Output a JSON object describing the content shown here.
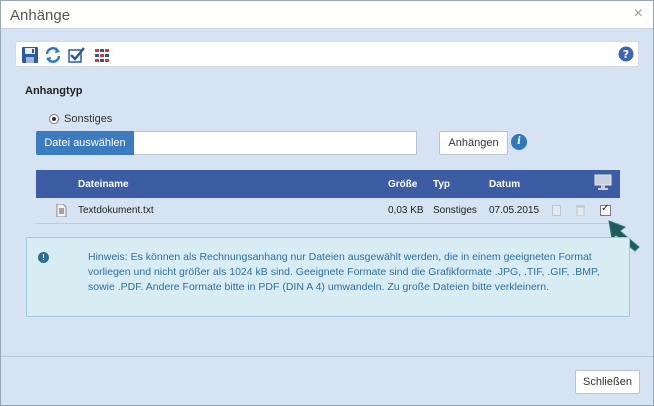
{
  "window": {
    "title": "Anhänge",
    "close_glyph": "×"
  },
  "toolbar": {
    "icons": [
      "save-icon",
      "refresh-icon",
      "check-icon",
      "grid-icon"
    ],
    "help_icon": "help-icon"
  },
  "section": {
    "title": "Anhangtyp"
  },
  "radio": {
    "label": "Sonstiges",
    "selected": true
  },
  "file": {
    "button_label": "Datei auswählen",
    "input_value": ""
  },
  "attach": {
    "button_label": "Anhängen"
  },
  "table": {
    "headers": {
      "name": "Dateiname",
      "size": "Größe",
      "type": "Typ",
      "date": "Datum"
    },
    "rows": [
      {
        "name": "Textdokument.txt",
        "size": "0,03 KB",
        "type": "Sonstiges",
        "date": "07.05.2015",
        "checked": true
      }
    ]
  },
  "hint": {
    "icon": "info-icon",
    "text": "Hinweis: Es können als Rechnungsanhang nur Dateien ausgewählt werden, die in einem geeigneten Format vorliegen und nicht größer als 1024 kB sind. Geeignete Formate sind die Grafikformate .JPG, .TIF, .GIF, .BMP, sowie .PDF. Andere Formate bitte in PDF (DIN A 4) umwandeln. Zu große Dateien bitte verkleinern."
  },
  "footer": {
    "close_label": "Schließen"
  },
  "colors": {
    "dialog_bg": "#d6e3f3",
    "table_header": "#3c5da4",
    "file_button": "#3b7bbf",
    "hint_bg": "#d8ecf3",
    "hint_text": "#2f6fa3",
    "arrow": "#1f5c5c"
  }
}
